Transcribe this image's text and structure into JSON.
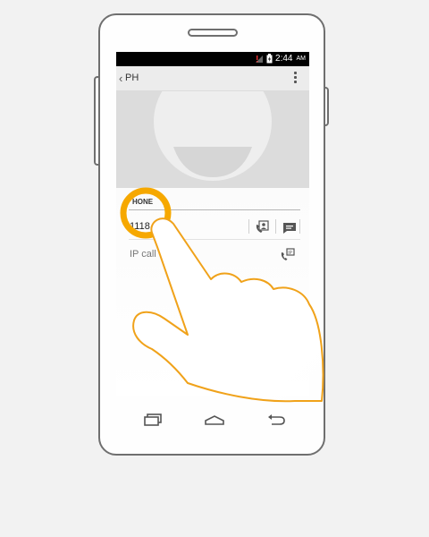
{
  "status_bar": {
    "time": "2:44",
    "ampm": "AM",
    "icons": [
      "signal-off-icon",
      "battery-charging-icon"
    ]
  },
  "action_bar": {
    "back_icon": "chevron-left-icon",
    "title": "PH",
    "overflow_icon": "overflow-menu-icon"
  },
  "contact_photo": {
    "icon": "default-avatar-icon"
  },
  "phone_section": {
    "label": "HONE",
    "number": "1118",
    "number_actions": [
      "call-icon",
      "message-icon"
    ],
    "ip_call_label": "IP call",
    "ip_call_icon": "ip-call-icon"
  },
  "navigation": {
    "buttons": [
      "recent-apps-icon",
      "home-icon",
      "back-arrow-icon"
    ]
  },
  "colors": {
    "highlight": "#f6a800",
    "hand_outline": "#f0a21a",
    "status_bar": "#000000",
    "action_bar": "#ececec",
    "photo_bg": "#dcdcdc"
  }
}
